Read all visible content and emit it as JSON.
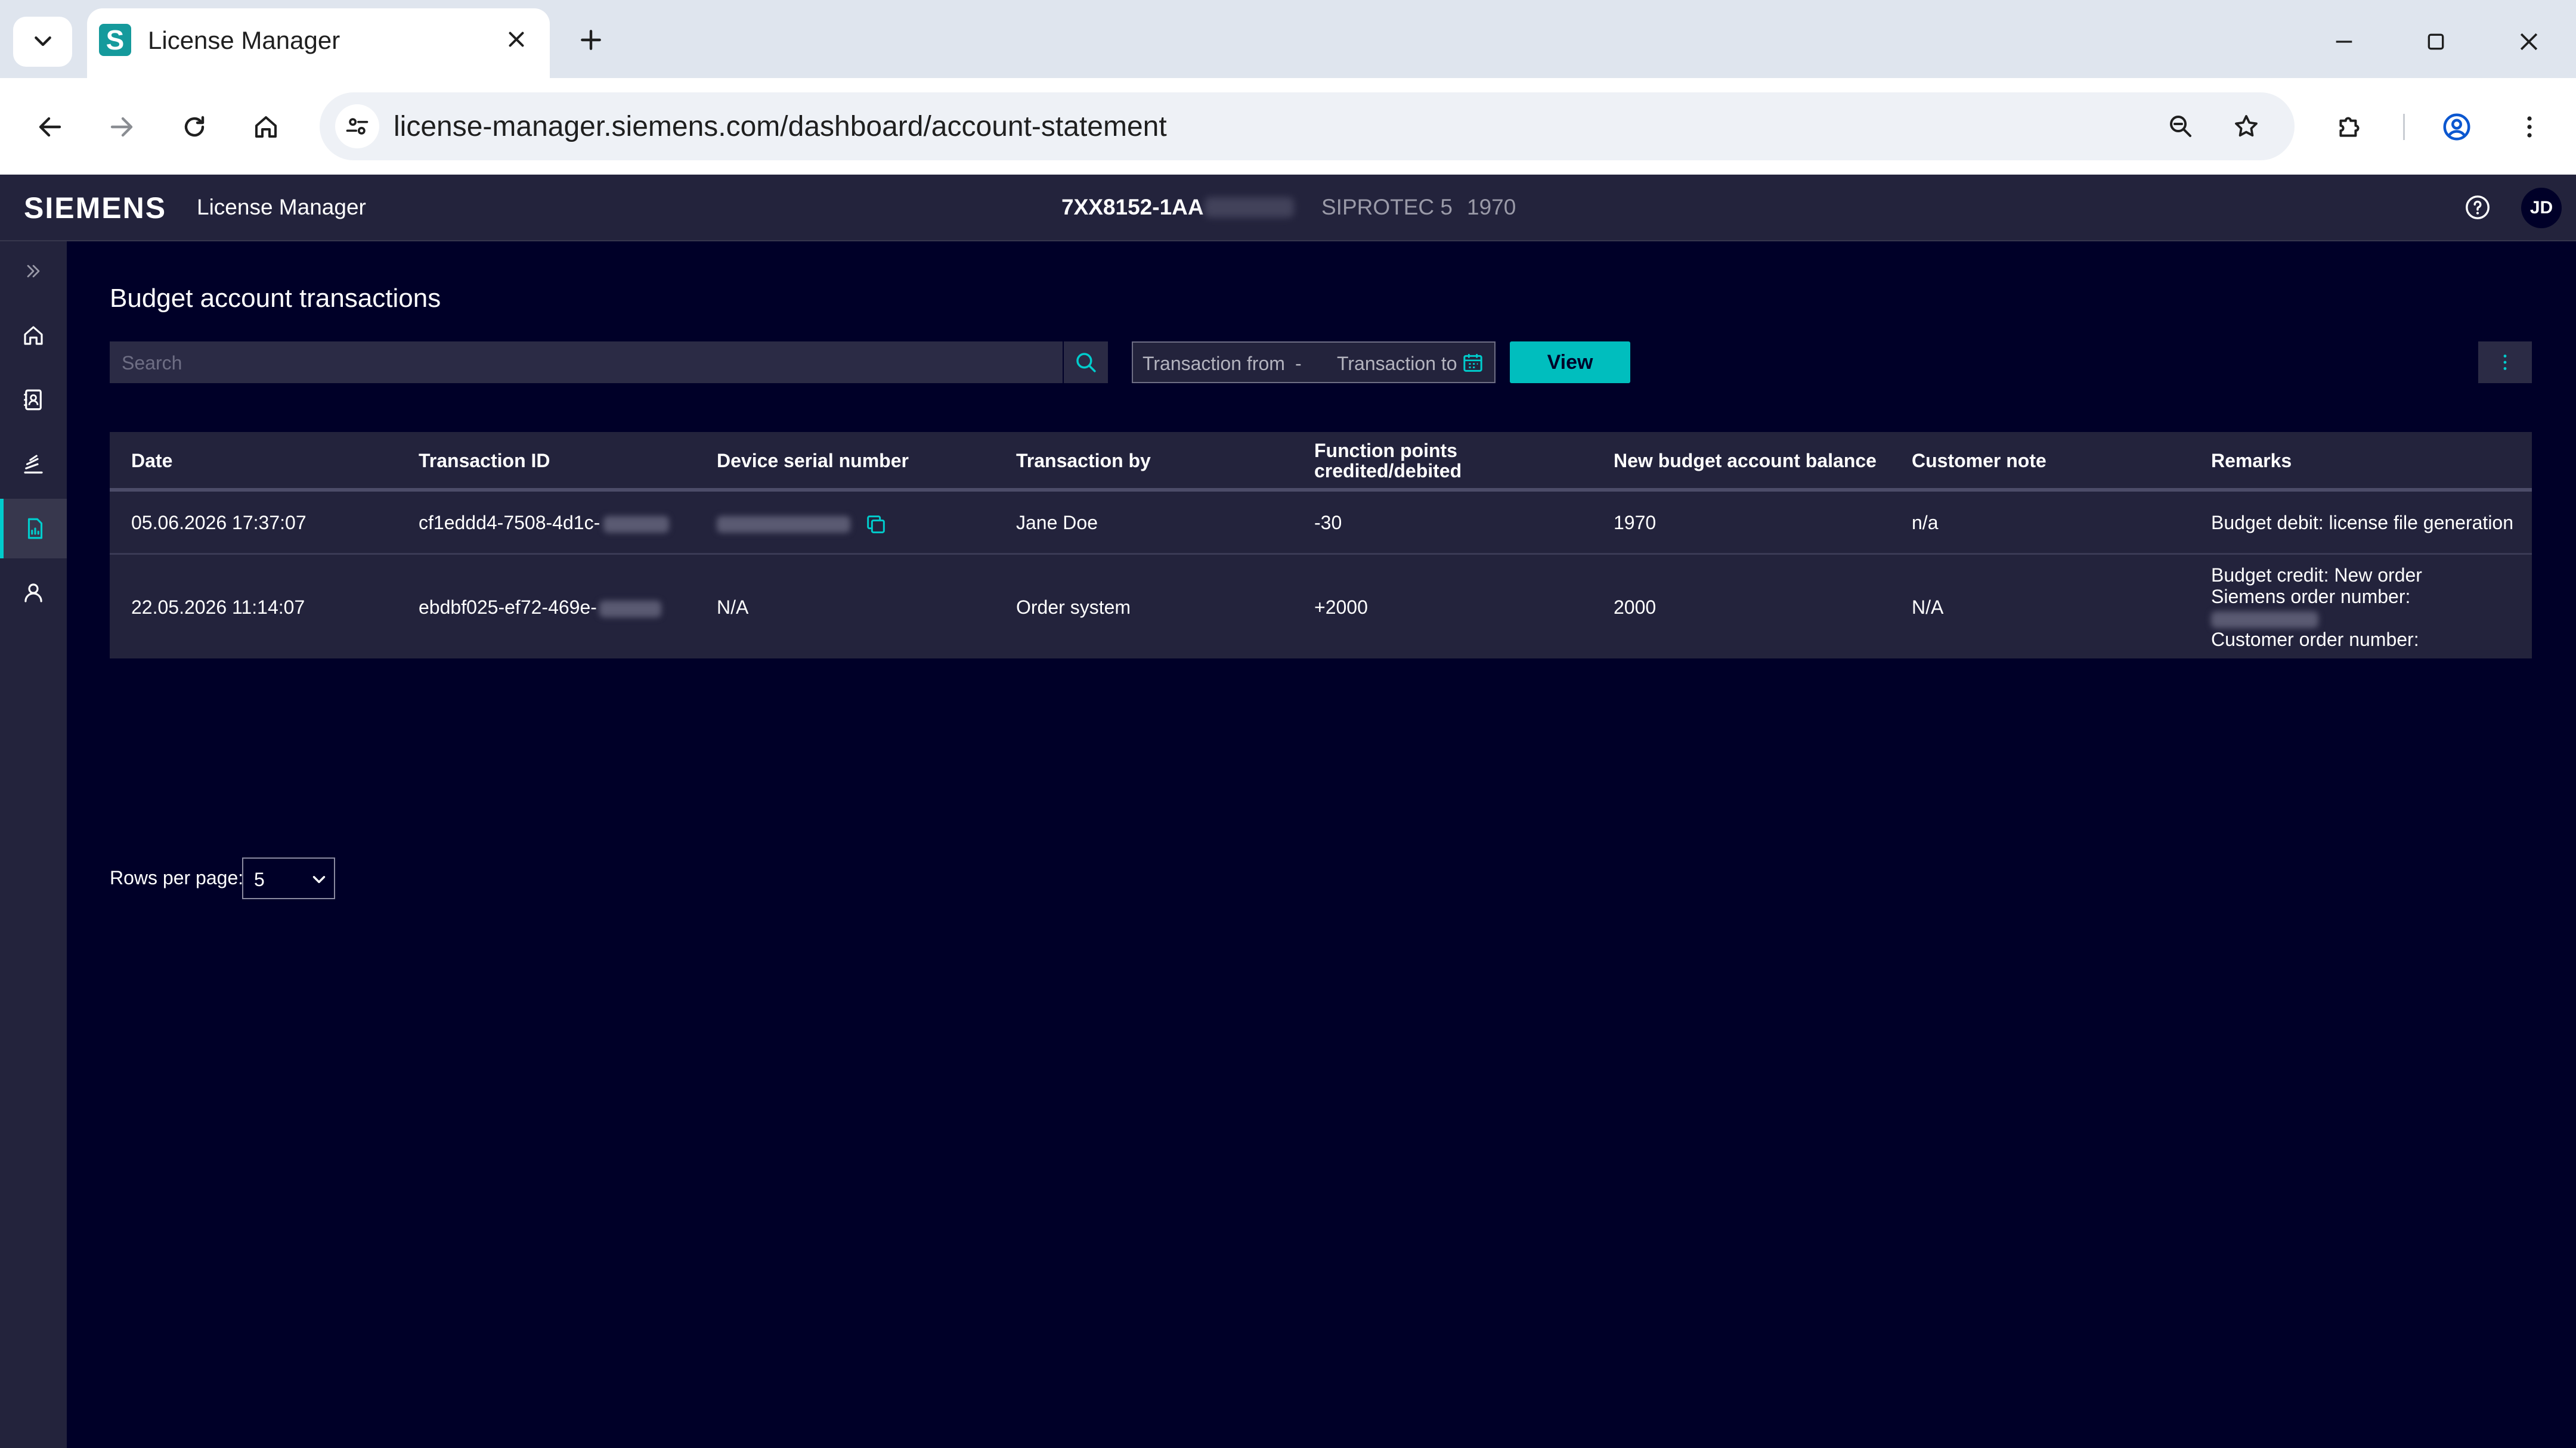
{
  "browser": {
    "tab_title": "License Manager",
    "favicon_letter": "S",
    "url": "license-manager.siemens.com/dashboard/account-statement"
  },
  "app": {
    "brand": "SIEMENS",
    "name": "License Manager",
    "device_id": "7XX8152-1AA",
    "device_model": "SIPROTEC 5",
    "device_balance": "1970",
    "user_initials": "JD",
    "accent_color": "#00bebe"
  },
  "page": {
    "title": "Budget account transactions",
    "search_placeholder": "Search",
    "transaction_from": "Transaction from",
    "range_separator": "-",
    "transaction_to": "Transaction to",
    "view_label": "View"
  },
  "table": {
    "headers": {
      "date": "Date",
      "transaction_id": "Transaction ID",
      "device_serial": "Device serial number",
      "transaction_by": "Transaction by",
      "function_points_1": "Function points",
      "function_points_2": "credited/debited",
      "balance": "New budget account balance",
      "customer_note": "Customer note",
      "remarks": "Remarks"
    },
    "rows": [
      {
        "date": "05.06.2026 17:37:07",
        "transaction_id": "cf1eddd4-7508-4d1c-",
        "device_serial": "",
        "transaction_by": "Jane Doe",
        "function_points": "-30",
        "balance": "1970",
        "customer_note": "n/a",
        "remarks_1": "Budget debit: license file generation"
      },
      {
        "date": "22.05.2026 11:14:07",
        "transaction_id": "ebdbf025-ef72-469e-",
        "device_serial": "N/A",
        "transaction_by": "Order system",
        "function_points": "+2000",
        "balance": "2000",
        "customer_note": "N/A",
        "remarks_1": "Budget credit: New order",
        "remarks_2": "Siemens order number:",
        "remarks_3": "Customer order number:"
      }
    ]
  },
  "pagination": {
    "rows_per_page_label": "Rows per page:",
    "rows_per_page_value": "5"
  }
}
